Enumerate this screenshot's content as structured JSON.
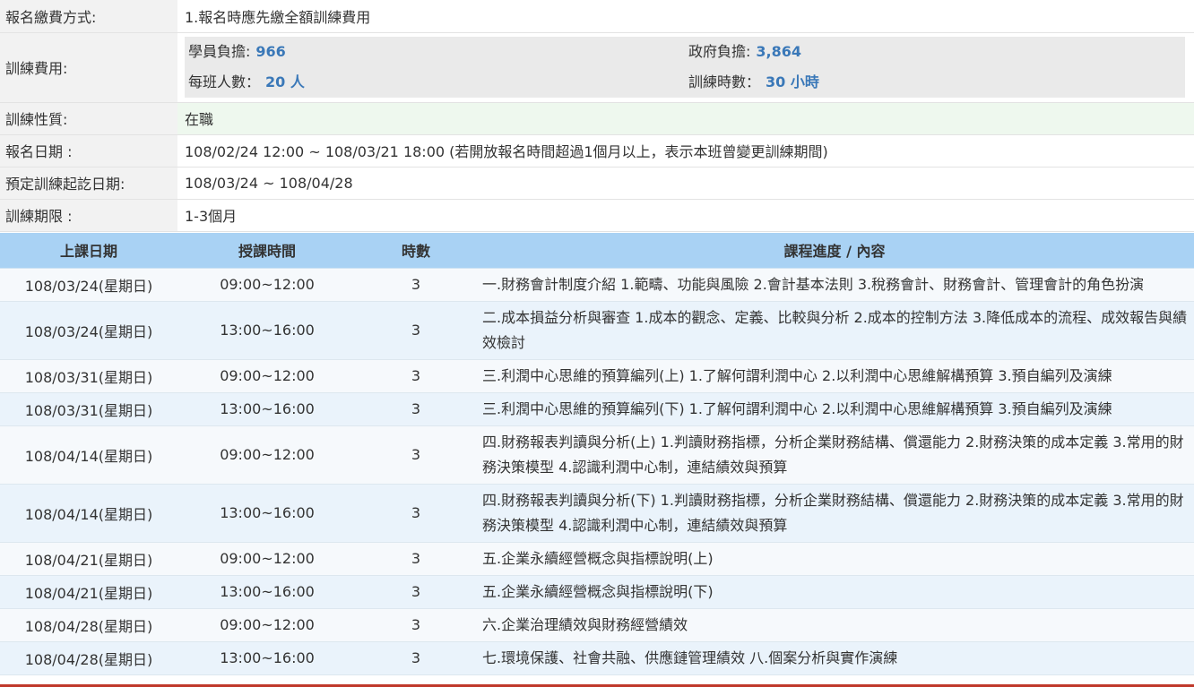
{
  "info": {
    "payment": {
      "label": "報名繳費方式:",
      "value": "1.報名時應先繳全額訓練費用"
    },
    "fee": {
      "label": "訓練費用:",
      "student_label": "學員負擔:",
      "student_value": "966",
      "gov_label": "政府負擔:",
      "gov_value": "3,864",
      "class_label": "每班人數：",
      "class_value": "20 人",
      "hours_label": "訓練時數：",
      "hours_value": "30 小時"
    },
    "nature": {
      "label": "訓練性質:",
      "value": "在職"
    },
    "reg_date": {
      "label": "報名日期 :",
      "value": "108/02/24 12:00 ~ 108/03/21 18:00 (若開放報名時間超過1個月以上，表示本班曾變更訓練期間)"
    },
    "period": {
      "label": "預定訓練起訖日期:",
      "value": "108/03/24 ~ 108/04/28"
    },
    "duration": {
      "label": "訓練期限 :",
      "value": "1-3個月"
    }
  },
  "schedule": {
    "headers": [
      "上課日期",
      "授課時間",
      "時數",
      "課程進度 / 內容"
    ],
    "rows": [
      {
        "date": "108/03/24(星期日)",
        "time": "09:00~12:00",
        "hours": "3",
        "content": "一.財務會計制度介紹 1.範疇、功能與風險 2.會計基本法則 3.稅務會計、財務會計、管理會計的角色扮演"
      },
      {
        "date": "108/03/24(星期日)",
        "time": "13:00~16:00",
        "hours": "3",
        "content": "二.成本損益分析與審查 1.成本的觀念、定義、比較與分析 2.成本的控制方法 3.降低成本的流程、成效報告與績效檢討"
      },
      {
        "date": "108/03/31(星期日)",
        "time": "09:00~12:00",
        "hours": "3",
        "content": "三.利潤中心思維的預算編列(上) 1.了解何謂利潤中心 2.以利潤中心思維解構預算 3.預自編列及演練"
      },
      {
        "date": "108/03/31(星期日)",
        "time": "13:00~16:00",
        "hours": "3",
        "content": "三.利潤中心思維的預算編列(下) 1.了解何謂利潤中心 2.以利潤中心思維解構預算 3.預自編列及演練"
      },
      {
        "date": "108/04/14(星期日)",
        "time": "09:00~12:00",
        "hours": "3",
        "content": "四.財務報表判讀與分析(上) 1.判讀財務指標，分析企業財務結構、償還能力 2.財務決策的成本定義 3.常用的財務決策模型 4.認識利潤中心制，連結績效與預算"
      },
      {
        "date": "108/04/14(星期日)",
        "time": "13:00~16:00",
        "hours": "3",
        "content": "四.財務報表判讀與分析(下) 1.判讀財務指標，分析企業財務結構、償還能力 2.財務決策的成本定義 3.常用的財務決策模型 4.認識利潤中心制，連結績效與預算"
      },
      {
        "date": "108/04/21(星期日)",
        "time": "09:00~12:00",
        "hours": "3",
        "content": "五.企業永續經營概念與指標說明(上)"
      },
      {
        "date": "108/04/21(星期日)",
        "time": "13:00~16:00",
        "hours": "3",
        "content": "五.企業永續經營概念與指標說明(下)"
      },
      {
        "date": "108/04/28(星期日)",
        "time": "09:00~12:00",
        "hours": "3",
        "content": "六.企業治理績效與財務經營績效"
      },
      {
        "date": "108/04/28(星期日)",
        "time": "13:00~16:00",
        "hours": "3",
        "content": "七.環境保護、社會共融、供應鏈管理績效 八.個案分析與實作演練"
      }
    ]
  }
}
